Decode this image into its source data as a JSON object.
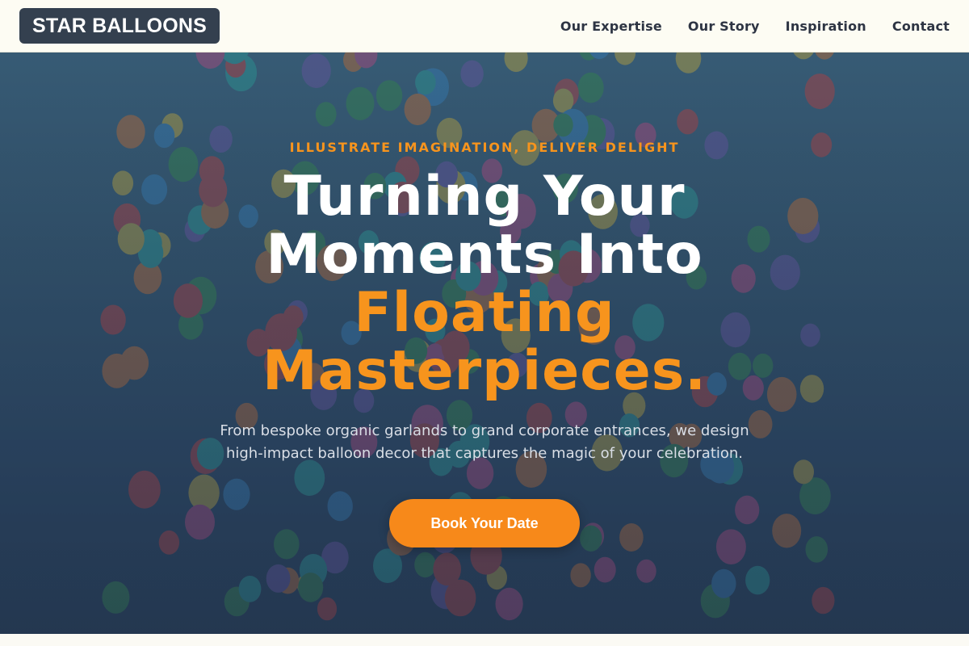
{
  "brand": {
    "logo_text": "STAR BALLOONS"
  },
  "nav": {
    "links": [
      "Our Expertise",
      "Our Story",
      "Inspiration",
      "Contact"
    ]
  },
  "hero": {
    "eyebrow": "ILLUSTRATE IMAGINATION, DELIVER DELIGHT",
    "headline_line1": "Turning Your",
    "headline_line2": "Moments Into",
    "headline_accent1": "Floating",
    "headline_accent2": "Masterpieces.",
    "subtext": "From bespoke organic garlands to grand corporate entrances, we design high-impact balloon decor that captures the magic of your celebration.",
    "cta_label": "Book Your Date",
    "background_image": "balloons-sky-photo"
  },
  "colors": {
    "accent": "#f7941d",
    "logo_bg": "#34404f",
    "nav_bg": "#fdfcf3",
    "hero_bg": "#35566f"
  }
}
